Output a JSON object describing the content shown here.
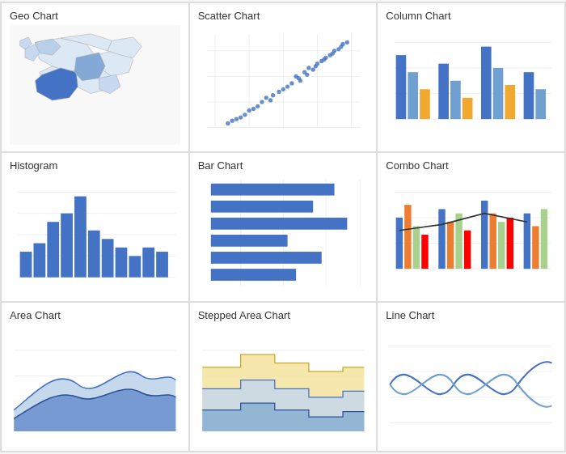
{
  "charts": [
    {
      "id": "geo-chart",
      "title": "Geo Chart"
    },
    {
      "id": "scatter-chart",
      "title": "Scatter Chart"
    },
    {
      "id": "column-chart",
      "title": "Column Chart"
    },
    {
      "id": "histogram-chart",
      "title": "Histogram"
    },
    {
      "id": "bar-chart",
      "title": "Bar Chart"
    },
    {
      "id": "combo-chart",
      "title": "Combo Chart"
    },
    {
      "id": "area-chart",
      "title": "Area Chart"
    },
    {
      "id": "stepped-area-chart",
      "title": "Stepped Area Chart"
    },
    {
      "id": "line-chart",
      "title": "Line Chart"
    }
  ]
}
